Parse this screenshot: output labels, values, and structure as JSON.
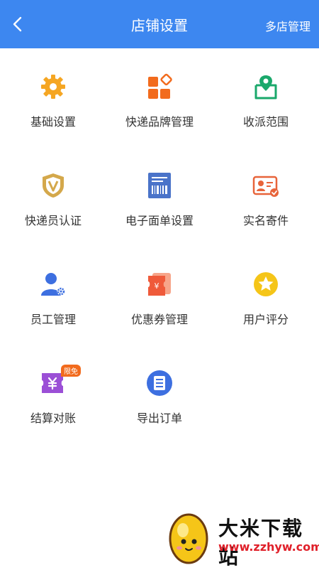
{
  "header": {
    "title": "店铺设置",
    "right_action": "多店管理"
  },
  "grid": {
    "items": [
      {
        "label": "基础设置",
        "icon": "gear-icon"
      },
      {
        "label": "快递品牌管理",
        "icon": "brand-blocks-icon"
      },
      {
        "label": "收派范围",
        "icon": "map-pin-icon"
      },
      {
        "label": "快递员认证",
        "icon": "shield-v-icon"
      },
      {
        "label": "电子面单设置",
        "icon": "receipt-barcode-icon"
      },
      {
        "label": "实名寄件",
        "icon": "id-card-icon"
      },
      {
        "label": "员工管理",
        "icon": "staff-gear-icon"
      },
      {
        "label": "优惠券管理",
        "icon": "coupon-icon"
      },
      {
        "label": "用户评分",
        "icon": "star-badge-icon"
      },
      {
        "label": "结算对账",
        "icon": "yen-wallet-icon",
        "badge": "限免"
      },
      {
        "label": "导出订单",
        "icon": "list-document-icon"
      }
    ]
  },
  "watermark": {
    "title": "大米下载站",
    "url": "www.zzhyw.com"
  },
  "colors": {
    "header_bg": "#3d87f0",
    "orange": "#f5a623",
    "brand_orange": "#f26b1d",
    "green": "#1aa86b",
    "blue": "#3d6fe0"
  }
}
